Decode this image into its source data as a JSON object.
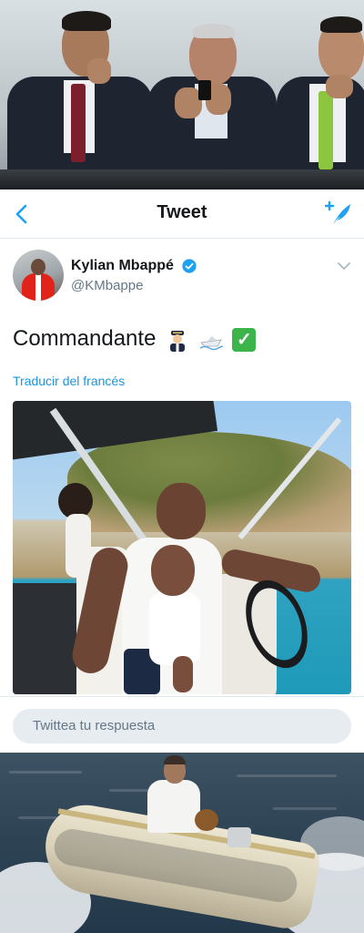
{
  "nav": {
    "title": "Tweet"
  },
  "author": {
    "name": "Kylian Mbappé",
    "handle": "@KMbappe",
    "verified": true
  },
  "tweet": {
    "text": "Commandante",
    "emojis": [
      "pilot",
      "speedboat",
      "white-check-mark"
    ],
    "check_mark": "✓",
    "translate_label": "Traducir del francés"
  },
  "reply": {
    "placeholder": "Twittea tu respuesta"
  },
  "colors": {
    "accent": "#1da1f2",
    "text_primary": "#14171a",
    "text_secondary": "#657786",
    "divider": "#e1e8ed",
    "reply_bg": "#e6ecf0",
    "check_green": "#3bb54a"
  },
  "icons": {
    "back": "chevron-left-icon",
    "compose": "compose-feather-icon",
    "verified": "verified-badge-icon",
    "menu": "chevron-down-icon"
  }
}
